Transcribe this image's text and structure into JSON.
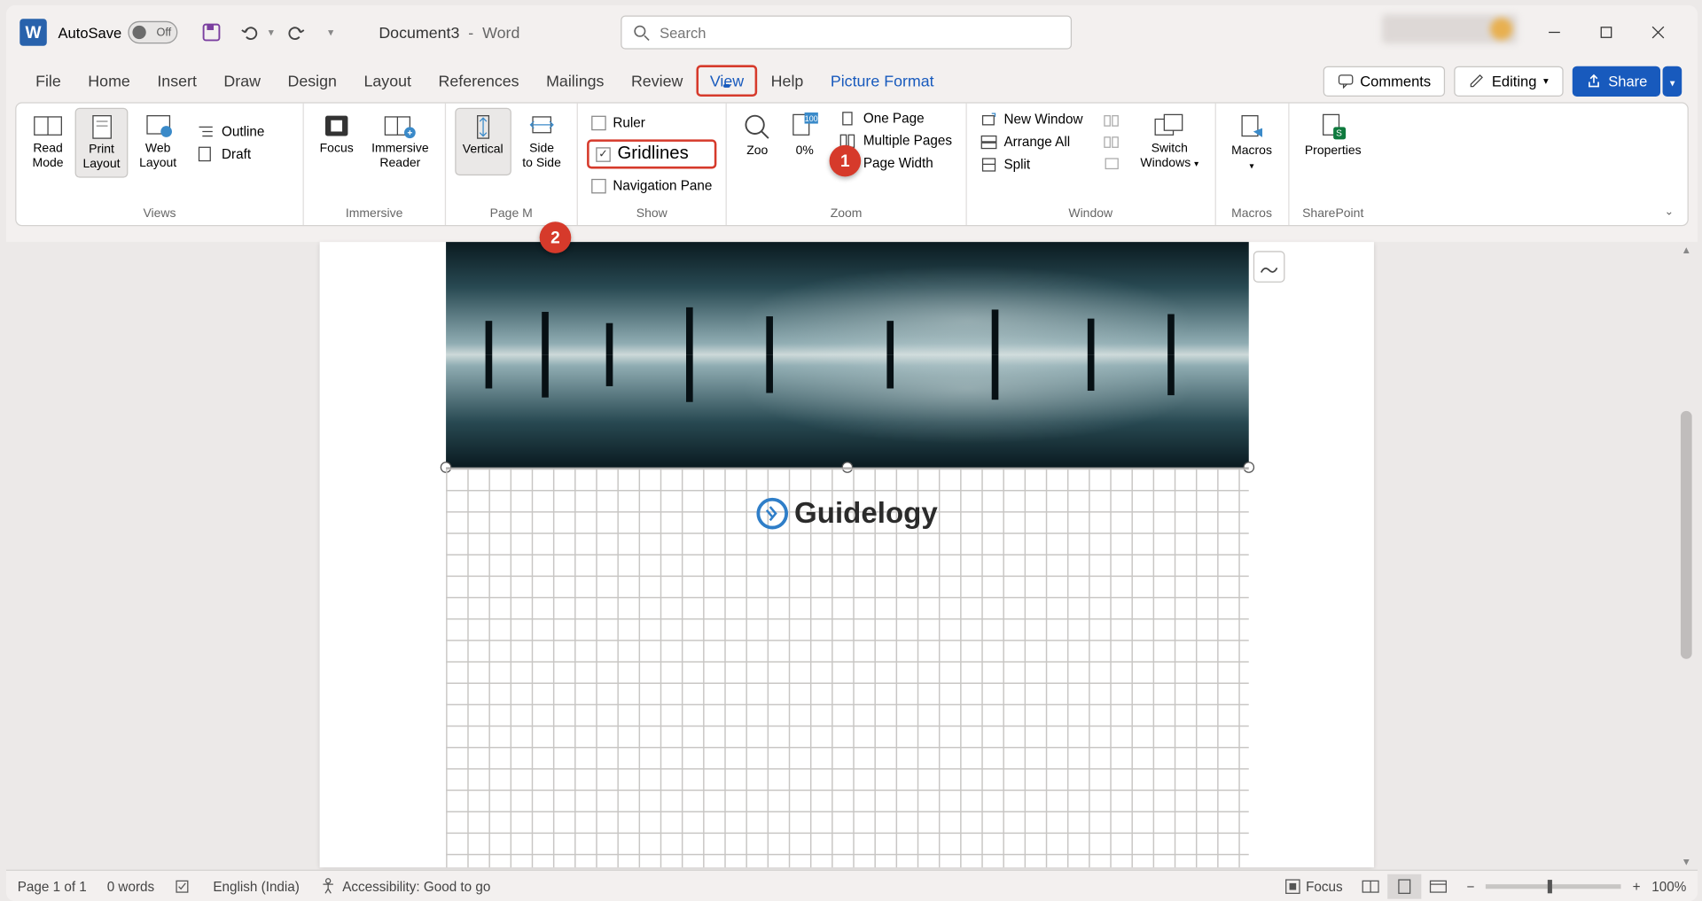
{
  "titlebar": {
    "autosave_label": "AutoSave",
    "autosave_state": "Off",
    "doc_name": "Document3",
    "app_name": "Word",
    "search_placeholder": "Search"
  },
  "tabs": {
    "file": "File",
    "home": "Home",
    "insert": "Insert",
    "draw": "Draw",
    "design": "Design",
    "layout": "Layout",
    "references": "References",
    "mailings": "Mailings",
    "review": "Review",
    "view": "View",
    "help": "Help",
    "picture_format": "Picture Format"
  },
  "tabrow_right": {
    "comments": "Comments",
    "editing": "Editing",
    "share": "Share"
  },
  "ribbon": {
    "views": {
      "read_mode": "Read\nMode",
      "print_layout": "Print\nLayout",
      "web_layout": "Web\nLayout",
      "outline": "Outline",
      "draft": "Draft",
      "group": "Views"
    },
    "immersive": {
      "focus": "Focus",
      "immersive_reader": "Immersive\nReader",
      "group": "Immersive"
    },
    "page_movement": {
      "vertical": "Vertical",
      "side_to_side": "Side\nto Side",
      "group": "Page M"
    },
    "show": {
      "ruler": "Ruler",
      "gridlines": "Gridlines",
      "nav_pane": "Navigation Pane",
      "group": "Show"
    },
    "zoom": {
      "zoom": "Zoo",
      "hundred": "0%",
      "one_page": "One Page",
      "multiple": "Multiple Pages",
      "page_width": "Page Width",
      "group": "Zoom"
    },
    "window": {
      "new_window": "New Window",
      "arrange": "Arrange All",
      "split": "Split",
      "switch": "Switch\nWindows",
      "group": "Window"
    },
    "macros": {
      "macros": "Macros",
      "group": "Macros"
    },
    "sharepoint": {
      "properties": "Properties",
      "group": "SharePoint"
    }
  },
  "annotations": {
    "b1": "1",
    "b2": "2"
  },
  "page": {
    "watermark": "Guidelogy"
  },
  "statusbar": {
    "page": "Page 1 of 1",
    "words": "0 words",
    "language": "English (India)",
    "accessibility": "Accessibility: Good to go",
    "focus": "Focus",
    "zoom": "100%"
  }
}
